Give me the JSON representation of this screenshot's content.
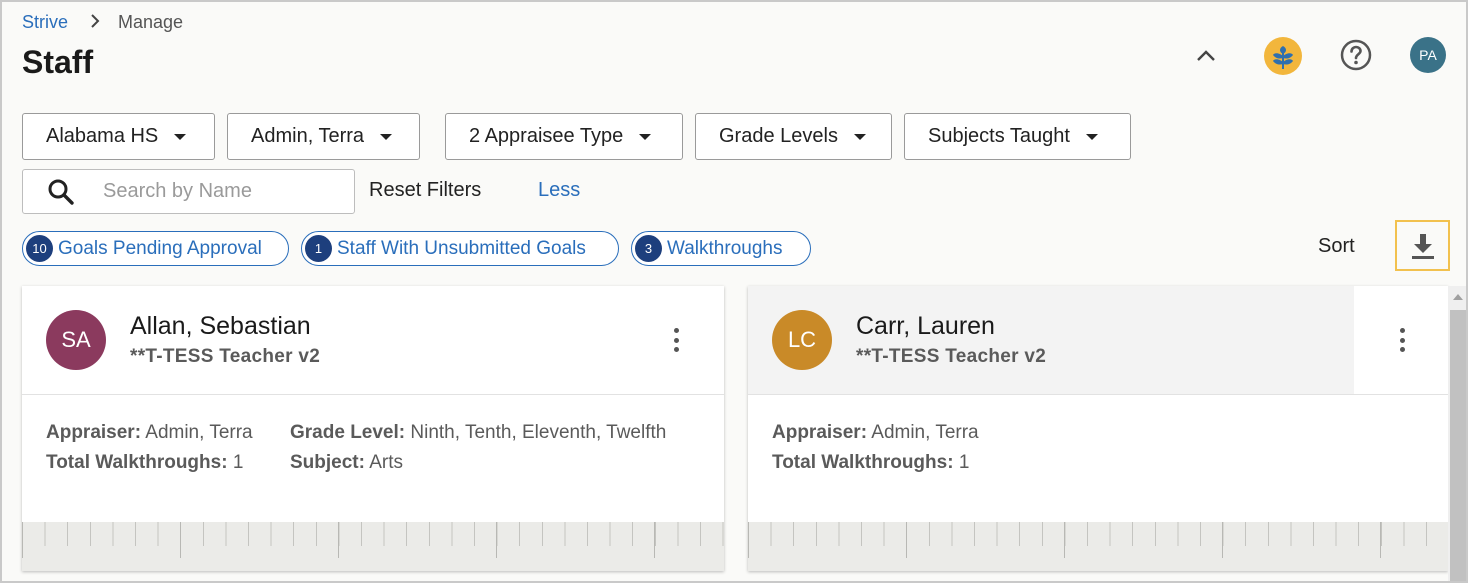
{
  "breadcrumb": {
    "root": "Strive",
    "current": "Manage"
  },
  "page": {
    "title": "Staff"
  },
  "header": {
    "avatar_initials": "PA",
    "avatar_color": "#3a7288",
    "brand_color": "#f2b63c"
  },
  "filters": [
    {
      "label": "Alabama HS"
    },
    {
      "label": "Admin, Terra"
    },
    {
      "label": "2 Appraisee Type"
    },
    {
      "label": "Grade Levels"
    },
    {
      "label": "Subjects Taught"
    }
  ],
  "search": {
    "placeholder": "Search by Name",
    "value": ""
  },
  "actions": {
    "reset": "Reset Filters",
    "less": "Less",
    "sort": "Sort"
  },
  "chips": [
    {
      "count": "10",
      "label": "Goals Pending Approval"
    },
    {
      "count": "1",
      "label": "Staff With Unsubmitted Goals"
    },
    {
      "count": "3",
      "label": "Walkthroughs"
    }
  ],
  "cards": [
    {
      "initials": "SA",
      "avatar_color": "#8b3a5e",
      "name": "Allan, Sebastian",
      "role": "**T-TESS Teacher v2",
      "appraiser_label": "Appraiser:",
      "appraiser": "Admin, Terra",
      "walkthroughs_label": "Total Walkthroughs:",
      "walkthroughs": "1",
      "grade_label": "Grade Level:",
      "grade": "Ninth, Tenth, Eleventh, Twelfth",
      "subject_label": "Subject:",
      "subject": "Arts"
    },
    {
      "initials": "LC",
      "avatar_color": "#c98a28",
      "name": "Carr, Lauren",
      "role": "**T-TESS Teacher v2",
      "appraiser_label": "Appraiser:",
      "appraiser": "Admin, Terra",
      "walkthroughs_label": "Total Walkthroughs:",
      "walkthroughs": "1"
    }
  ],
  "colors": {
    "link": "#2a6ebb",
    "chip_badge": "#1d3f7d",
    "download_focus": "#f2c14e"
  }
}
